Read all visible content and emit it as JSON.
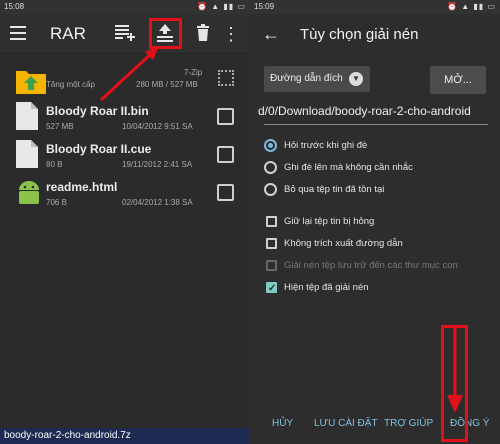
{
  "left": {
    "status_time": "15:08",
    "app_title": "RAR",
    "files": [
      {
        "name": "",
        "sub": "Tăng một cấp",
        "type": "7-Zip",
        "size": "280 MB / 527 MB",
        "kind": "up-folder"
      },
      {
        "name": "Bloody Roar II.bin",
        "size": "527 MB",
        "date": "10/04/2012 9:51 SA",
        "kind": "file"
      },
      {
        "name": "Bloody Roar II.cue",
        "size": "80 B",
        "date": "19/11/2012 2:41 SA",
        "kind": "file"
      },
      {
        "name": "readme.html",
        "size": "706 B",
        "date": "02/04/2012 1:38 SA",
        "kind": "android"
      }
    ],
    "bottom_label": "boody-roar-2-cho-android.7z"
  },
  "right": {
    "status_time": "15:09",
    "title": "Tùy chọn giải nén",
    "dest_label": "Đường dẫn đích",
    "more_label": "MỞ...",
    "path_value": "d/0/Download/boody-roar-2-cho-android",
    "radios": [
      {
        "label": "Hỏi trước khi ghi đè",
        "checked": true
      },
      {
        "label": "Ghi đè lên mà không cần nhắc",
        "checked": false
      },
      {
        "label": "Bỏ qua tệp tin đã tồn tại",
        "checked": false
      }
    ],
    "checks": [
      {
        "label": "Giữ lại tệp tin bị hỏng",
        "checked": false,
        "disabled": false
      },
      {
        "label": "Không trích xuất đường dẫn",
        "checked": false,
        "disabled": false
      },
      {
        "label": "Giải nén tệp lưu trữ đến các thư mục con",
        "checked": false,
        "disabled": true
      },
      {
        "label": "Hiện tệp đã giải nén",
        "checked": true,
        "disabled": false
      }
    ],
    "footer": {
      "cancel": "HỦY",
      "save": "LƯU CÀI ĐẶT",
      "help": "TRỢ GIÚP",
      "ok": "ĐỒNG Ý"
    }
  },
  "colors": {
    "highlight": "#e3101a",
    "accent": "#82c1e2",
    "checkbox_checked": "#80cbc4",
    "bottom_bar": "#1f2a52"
  }
}
